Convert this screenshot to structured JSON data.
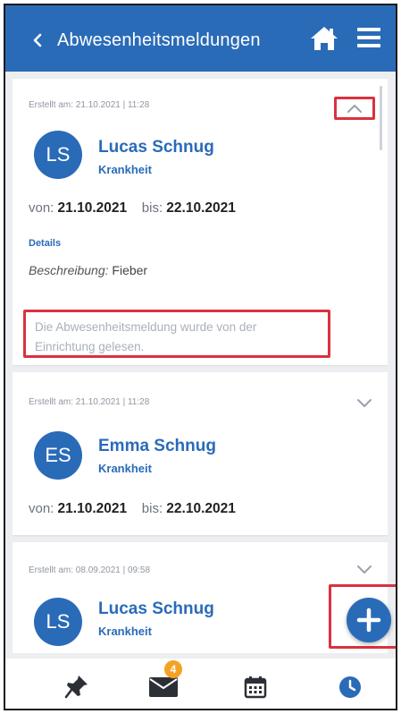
{
  "header": {
    "title": "Abwesenheitsmeldungen"
  },
  "cards": [
    {
      "created": "Erstellt am: 21.10.2021 | 11:28",
      "initials": "LS",
      "name": "Lucas Schnug",
      "reason": "Krankheit",
      "from_label": "von:",
      "from": "21.10.2021",
      "to_label": "bis:",
      "to": "22.10.2021",
      "details_label": "Details",
      "description_label": "Beschreibung:",
      "description": "Fieber",
      "notice": "Die Abwesenheitsmeldung wurde von der Einrichtung gelesen.",
      "expanded": true
    },
    {
      "created": "Erstellt am: 21.10.2021 | 11:28",
      "initials": "ES",
      "name": "Emma Schnug",
      "reason": "Krankheit",
      "from_label": "von:",
      "from": "21.10.2021",
      "to_label": "bis:",
      "to": "22.10.2021",
      "expanded": false
    },
    {
      "created": "Erstellt am: 08.09.2021 | 09:58",
      "initials": "LS",
      "name": "Lucas Schnug",
      "reason": "Krankheit",
      "expanded": false
    }
  ],
  "tabbar": {
    "messages_badge": "4"
  },
  "icons": {
    "back": "chevron-left-icon",
    "home": "home-icon",
    "menu": "menu-icon",
    "collapse": "chevron-up-icon",
    "expand": "chevron-down-icon",
    "add": "plus-icon",
    "pin": "pin-icon",
    "messages": "envelope-icon",
    "calendar": "calendar-icon",
    "history": "clock-icon"
  },
  "colors": {
    "primary": "#2a6bb8",
    "highlight": "#d9323f",
    "badge": "#f4a223",
    "background": "#eceef1"
  }
}
